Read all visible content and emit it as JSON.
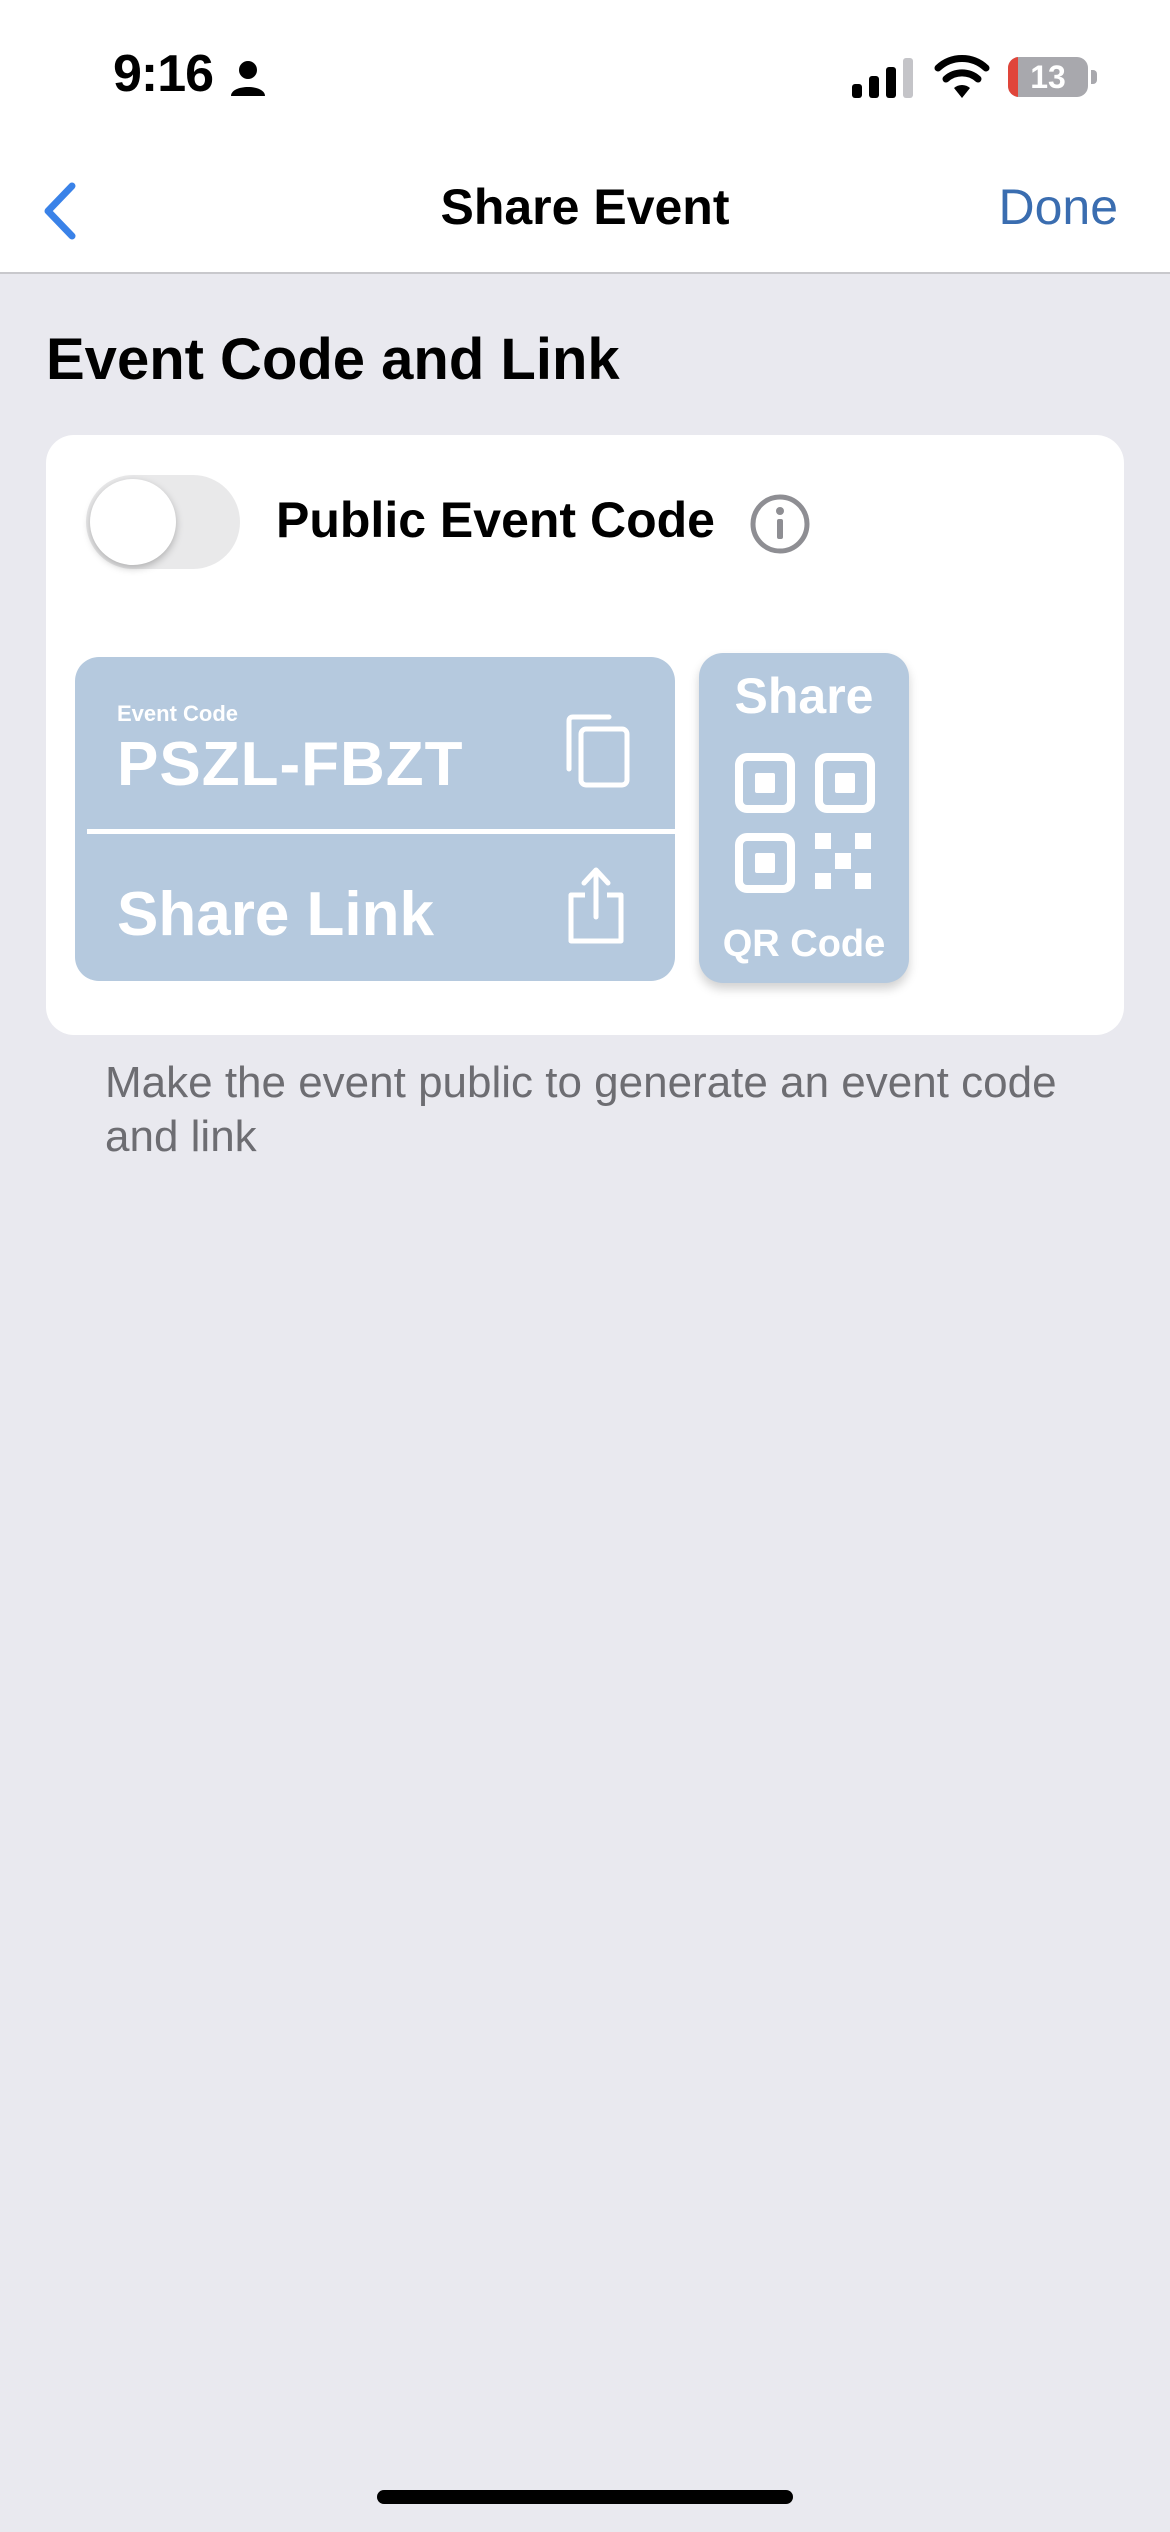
{
  "status_bar": {
    "time": "9:16",
    "battery_level": "13",
    "battery_fraction": 0.13
  },
  "nav": {
    "title": "Share Event",
    "done_label": "Done",
    "back_icon": "chevron-left-icon",
    "accent_color": "#3a6db0"
  },
  "section": {
    "title": "Event Code and Link"
  },
  "card": {
    "toggle_label": "Public Event Code",
    "toggle_on": false,
    "info_icon": "info-circle-icon",
    "code_caption": "Event Code",
    "code_value": "PSZL-FBZT",
    "copy_icon": "copy-icon",
    "share_link_label": "Share Link",
    "share_icon": "share-icon",
    "qr_top_label": "Share",
    "qr_bottom_label": "QR Code",
    "qr_icon": "qr-code-icon",
    "disabled_fill_color": "#b5c9de"
  },
  "footer_note": "Make the event public to generate an event code and link"
}
